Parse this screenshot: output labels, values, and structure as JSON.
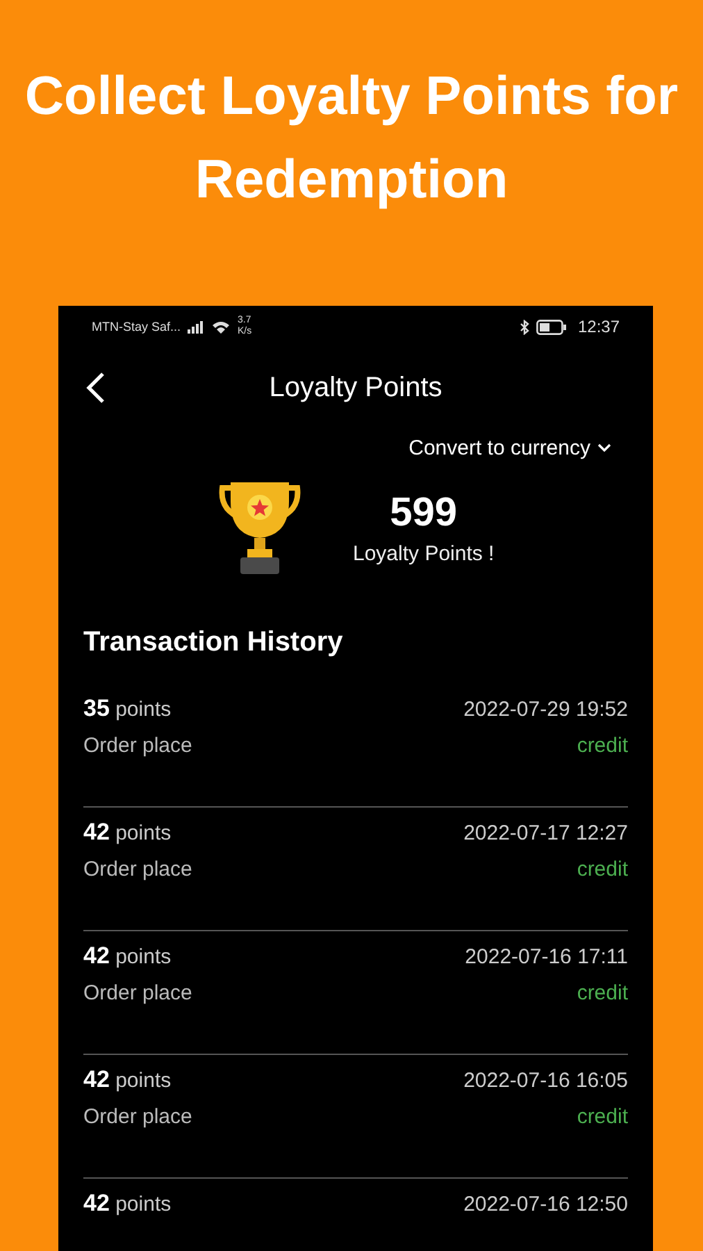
{
  "headline": "Collect Loyalty Points for Redemption",
  "status_bar": {
    "carrier": "MTN-Stay Saf...",
    "speed_value": "3.7",
    "speed_unit": "K/s",
    "time": "12:37"
  },
  "app_bar": {
    "title": "Loyalty Points"
  },
  "convert": {
    "label": "Convert to currency"
  },
  "summary": {
    "points": "599",
    "label": "Loyalty Points !"
  },
  "history": {
    "title": "Transaction History",
    "items": [
      {
        "points": "**35** points",
        "date": "2022-07-29 19:52",
        "description": "Order place",
        "type": "credit"
      },
      {
        "points": "**42** points",
        "date": "2022-07-17 12:27",
        "description": "Order place",
        "type": "credit"
      },
      {
        "points": "**42** points",
        "date": "2022-07-16 17:11",
        "description": "Order place",
        "type": "credit"
      },
      {
        "points": "**42** points",
        "date": "2022-07-16 16:05",
        "description": "Order place",
        "type": "credit"
      },
      {
        "points": "**42** points",
        "date": "2022-07-16 12:50"
      }
    ]
  }
}
